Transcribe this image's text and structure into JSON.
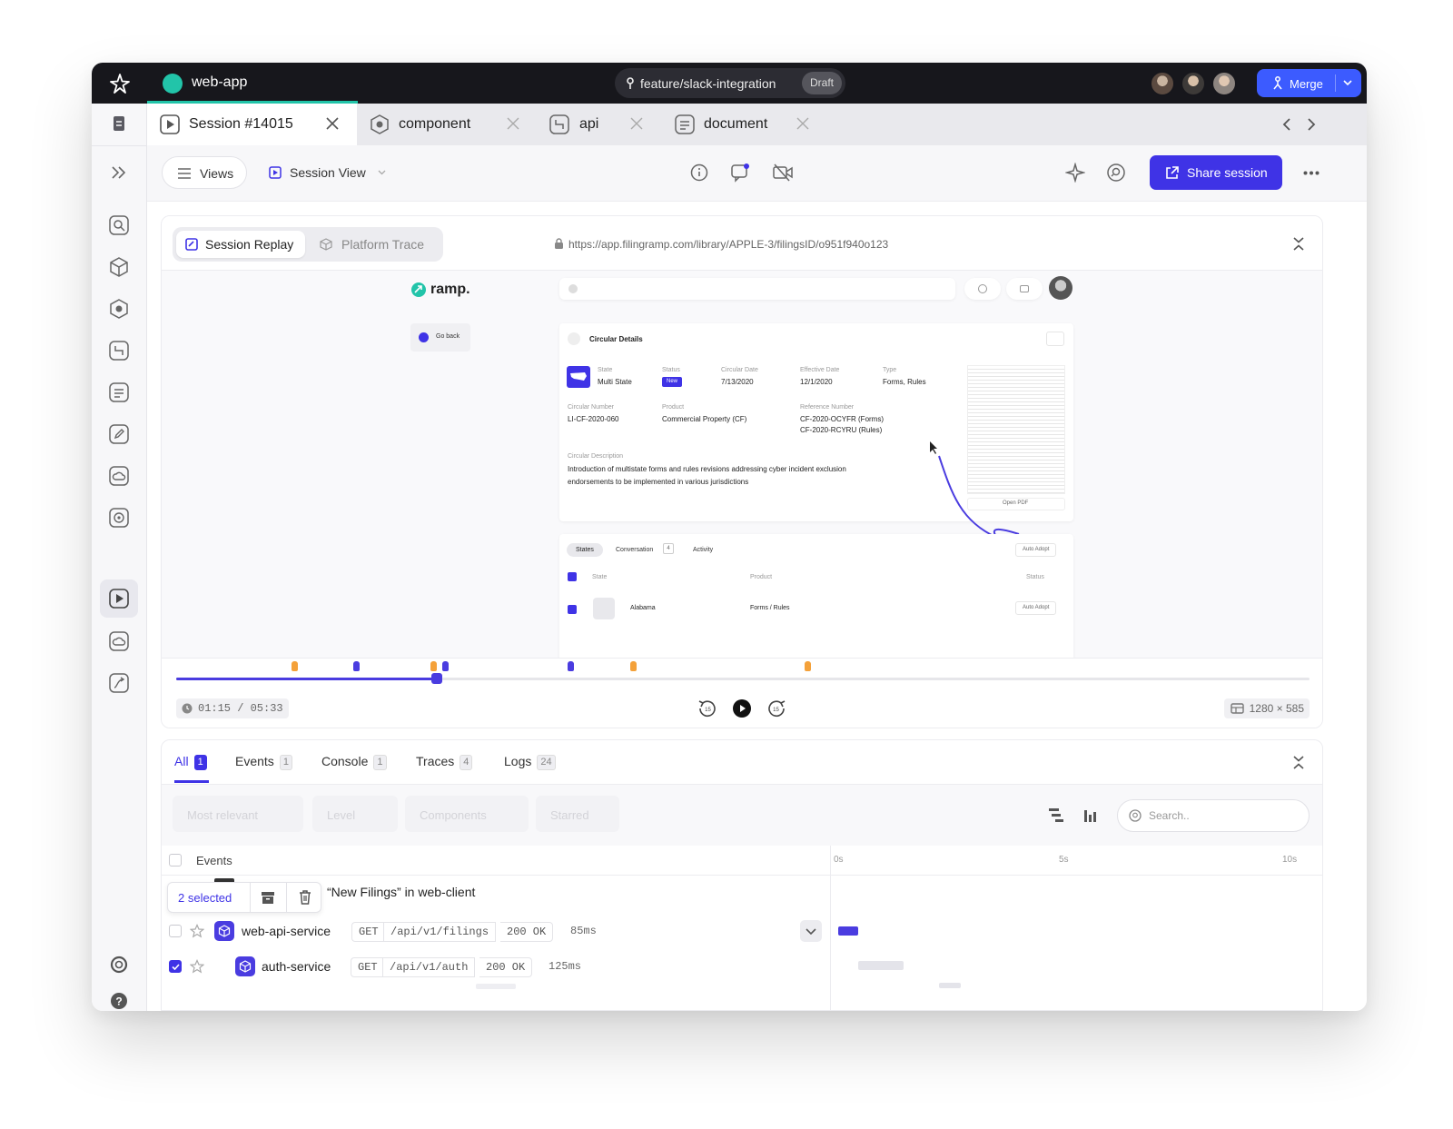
{
  "app": {
    "title": "web-app",
    "branch": "feature/slack-integration",
    "draft_label": "Draft",
    "merge_label": "Merge",
    "accent": "#3f33e6"
  },
  "tabs": [
    {
      "label": "Session #14015",
      "icon": "play-square-icon"
    },
    {
      "label": "component",
      "icon": "hexagon-icon"
    },
    {
      "label": "api",
      "icon": "api-icon"
    },
    {
      "label": "document",
      "icon": "document-icon"
    }
  ],
  "toolbar": {
    "views_label": "Views",
    "session_view_label": "Session View",
    "share_label": "Share session"
  },
  "replay": {
    "tab_replay": "Session Replay",
    "tab_trace": "Platform Trace",
    "url": "https://app.filingramp.com/library/APPLE-3/filingsID/o951f940o123",
    "time": "01:15 / 05:33",
    "resolution": "1280 × 585",
    "progress": 0.23,
    "markers_orange": [
      0.104,
      0.227,
      0.403,
      0.557
    ],
    "markers_blue": [
      0.159,
      0.237,
      0.348
    ]
  },
  "page": {
    "brand": "ramp.",
    "go_back": "Go back",
    "details_title": "Circular Details",
    "f_state_l": "State",
    "f_state_v": "Multi State",
    "f_status_l": "Status",
    "f_status_v": "New",
    "f_cdate_l": "Circular Date",
    "f_cdate_v": "7/13/2020",
    "f_edate_l": "Effective Date",
    "f_edate_v": "12/1/2020",
    "f_type_l": "Type",
    "f_type_v": "Forms, Rules",
    "f_cnum_l": "Circular Number",
    "f_cnum_v": "LI-CF-2020-060",
    "f_prod_l": "Product",
    "f_prod_v": "Commercial Property (CF)",
    "f_ref_l": "Reference Number",
    "f_ref_v1": "CF-2020-OCYFR (Forms)",
    "f_ref_v2": "CF-2020-RCYRU (Rules)",
    "desc_l": "Circular Description",
    "desc_v1": "Introduction of multistate forms and rules revisions addressing cyber incident exclusion",
    "desc_v2": "endorsements to be implemented in various jurisdictions",
    "open_pdf": "Open PDF",
    "tab_states": "States",
    "tab_conv": "Conversation",
    "tab_conv_count": "4",
    "tab_activity": "Activity",
    "auto_adopt": "Auto Adopt",
    "col_state": "State",
    "col_product": "Product",
    "col_status": "Status",
    "row_state": "Alabama",
    "row_product": "Forms / Rules"
  },
  "bottom": {
    "tabs": [
      {
        "label": "All",
        "count": "1"
      },
      {
        "label": "Events",
        "count": "1"
      },
      {
        "label": "Console",
        "count": "1"
      },
      {
        "label": "Traces",
        "count": "4"
      },
      {
        "label": "Logs",
        "count": "24"
      }
    ],
    "filters": [
      "Most relevant",
      "Level",
      "Components",
      "Starred"
    ],
    "search_placeholder": "Search..",
    "events_header": "Events",
    "ticks": [
      "0s",
      "5s",
      "10s"
    ],
    "selected_label": "2 selected",
    "group_label": "“New Filings” in web-client",
    "rows": [
      {
        "service": "web-api-service",
        "method": "GET",
        "path": "/api/v1/filings",
        "status": "200 OK",
        "duration": "85ms",
        "checked": false
      },
      {
        "service": "auth-service",
        "method": "GET",
        "path": "/api/v1/auth",
        "status": "200 OK",
        "duration": "125ms",
        "checked": true
      }
    ]
  }
}
